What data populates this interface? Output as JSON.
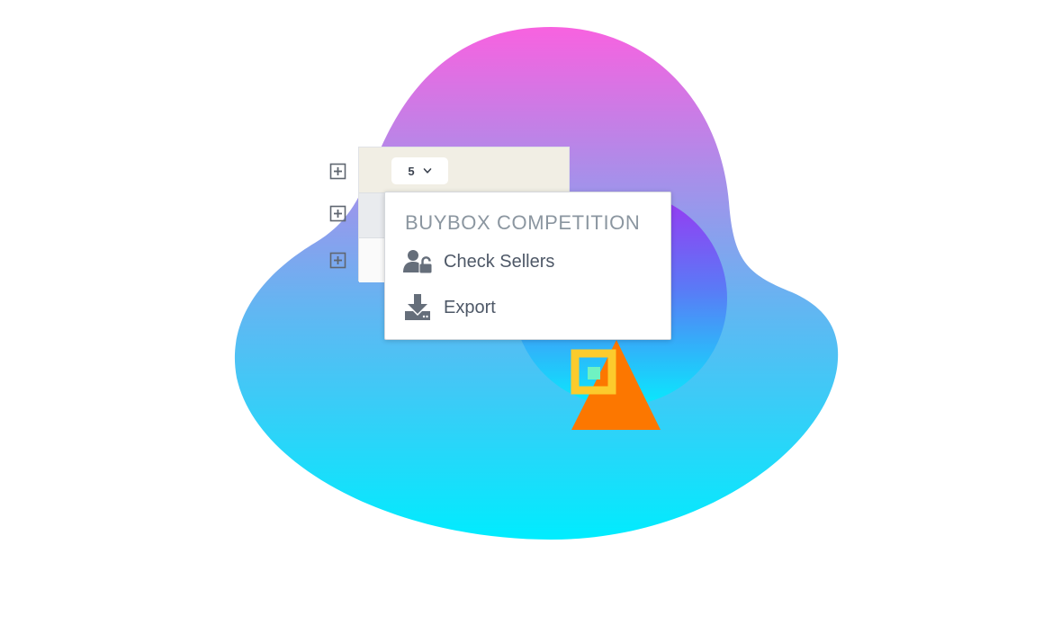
{
  "table": {
    "page_size_value": "5"
  },
  "menu": {
    "title": "BUYBOX COMPETITION",
    "items": [
      {
        "label": "Check Sellers",
        "icon": "user-unlock-icon"
      },
      {
        "label": "Export",
        "icon": "download-icon"
      }
    ]
  },
  "colors": {
    "blob_top": "#f862e0",
    "blob_bottom": "#00ecfe",
    "circle_top": "#9b36f2",
    "circle_bottom": "#08eafd",
    "triangle": "#fc7700",
    "square_outline": "#fccb2c",
    "square_fill": "#6ff2c2",
    "menu_title": "#8b96a0",
    "menu_text": "#4e5867",
    "icon_color": "#656e7a"
  }
}
